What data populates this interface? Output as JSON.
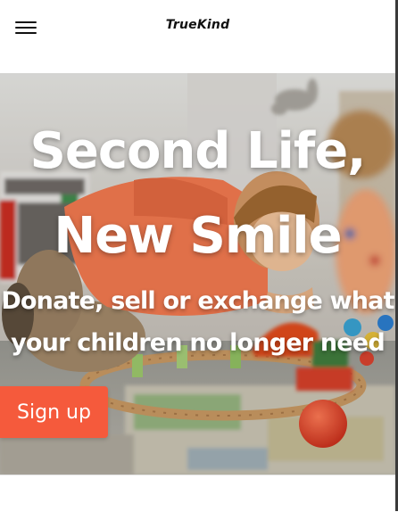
{
  "header": {
    "brand": "TrueKind",
    "menu_icon": "hamburger-menu-icon"
  },
  "hero": {
    "title_line1": "Second Life,",
    "title_line2": "New Smile",
    "subtitle_line1": "Donate, sell or exchange what",
    "subtitle_line2": "your children no longer need",
    "cta_label": "Sign up",
    "background_image": "child-playing-with-toys-photo"
  },
  "colors": {
    "accent": "#f55a3c",
    "header_bg": "#ffffff",
    "hero_text": "#ffffff"
  }
}
